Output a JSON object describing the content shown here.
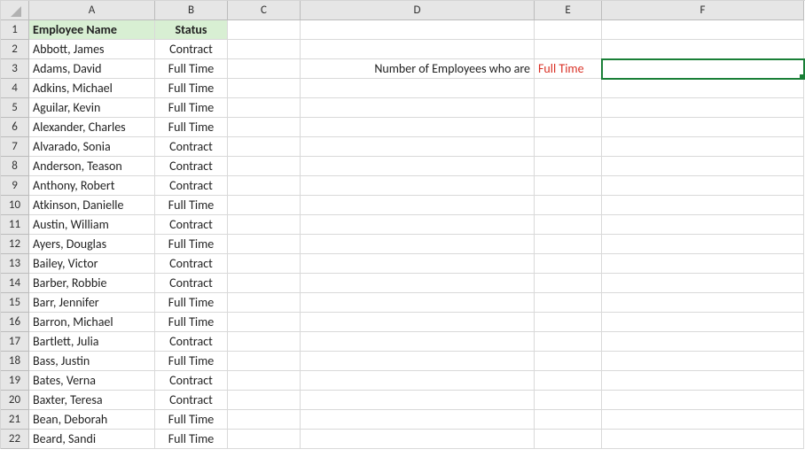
{
  "columns": [
    "A",
    "B",
    "C",
    "D",
    "E",
    "F"
  ],
  "row_count": 22,
  "selected_cell": "F3",
  "header_row": {
    "A": "Employee Name",
    "B": "Status"
  },
  "label_cell": {
    "addr": "D3",
    "text": "Number of Employees who are"
  },
  "criteria_cell": {
    "addr": "E3",
    "text": "Full Time"
  },
  "employees": [
    {
      "name": "Abbott, James",
      "status": "Contract"
    },
    {
      "name": "Adams, David",
      "status": "Full Time"
    },
    {
      "name": "Adkins, Michael",
      "status": "Full Time"
    },
    {
      "name": "Aguilar, Kevin",
      "status": "Full Time"
    },
    {
      "name": "Alexander, Charles",
      "status": "Full Time"
    },
    {
      "name": "Alvarado, Sonia",
      "status": "Contract"
    },
    {
      "name": "Anderson, Teason",
      "status": "Contract"
    },
    {
      "name": "Anthony, Robert",
      "status": "Contract"
    },
    {
      "name": "Atkinson, Danielle",
      "status": "Full Time"
    },
    {
      "name": "Austin, William",
      "status": "Contract"
    },
    {
      "name": "Ayers, Douglas",
      "status": "Full Time"
    },
    {
      "name": "Bailey, Victor",
      "status": "Contract"
    },
    {
      "name": "Barber, Robbie",
      "status": "Contract"
    },
    {
      "name": "Barr, Jennifer",
      "status": "Full Time"
    },
    {
      "name": "Barron, Michael",
      "status": "Full Time"
    },
    {
      "name": "Bartlett, Julia",
      "status": "Contract"
    },
    {
      "name": "Bass, Justin",
      "status": "Full Time"
    },
    {
      "name": "Bates, Verna",
      "status": "Contract"
    },
    {
      "name": "Baxter, Teresa",
      "status": "Contract"
    },
    {
      "name": "Bean, Deborah",
      "status": "Full Time"
    },
    {
      "name": "Beard, Sandi",
      "status": "Full Time"
    }
  ]
}
